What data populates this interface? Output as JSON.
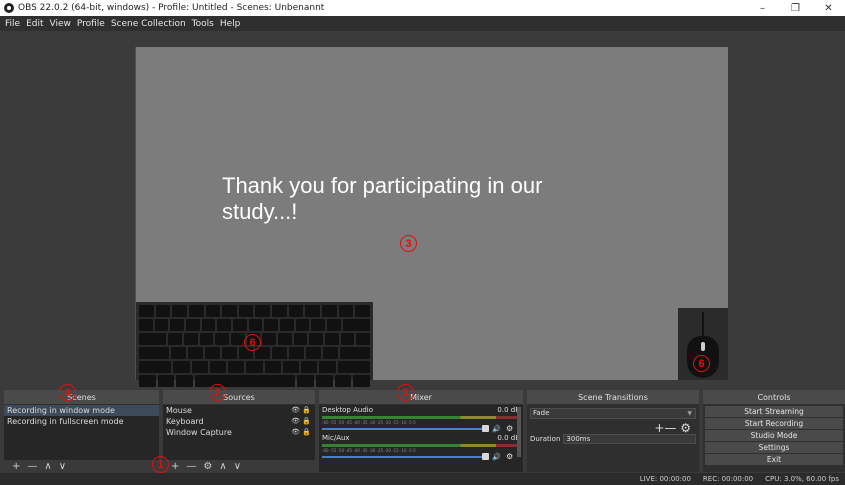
{
  "window": {
    "title": "OBS 22.0.2 (64-bit, windows) - Profile: Untitled - Scenes: Unbenannt",
    "minimize": "–",
    "maximize": "❐",
    "close": "✕"
  },
  "menu": [
    "File",
    "Edit",
    "View",
    "Profile",
    "Scene Collection",
    "Tools",
    "Help"
  ],
  "preview": {
    "text": "Thank you for participating in our study...!",
    "markers": {
      "canvas": "3",
      "keyboard": "6",
      "mouse": "6"
    }
  },
  "scenes": {
    "title": "Scenes",
    "marker": "4",
    "items": [
      "Recording in window mode",
      "Recording in fullscreen mode"
    ],
    "footer": [
      "+",
      "—",
      "∧",
      "∨"
    ]
  },
  "sources": {
    "title": "Sources",
    "marker": "2",
    "footer_marker": "1",
    "items": [
      "Mouse",
      "Keyboard",
      "Window Capture"
    ],
    "item_icons": "👁 🔒",
    "footer": [
      "+",
      "—",
      "⚙",
      "∧",
      "∨"
    ]
  },
  "mixer": {
    "title": "Mixer",
    "marker": "5",
    "channels": [
      {
        "name": "Desktop Audio",
        "level": "0.0 dB"
      },
      {
        "name": "Mic/Aux",
        "level": "0.0 dB"
      }
    ],
    "ticks": "-60 -55 -50 -45 -40 -35 -30 -25 -20 -15 -10 -5 0"
  },
  "transitions": {
    "title": "Scene Transitions",
    "selected": "Fade",
    "add_remove": "+— ⚙",
    "duration_label": "Duration",
    "duration_value": "300ms"
  },
  "controls": {
    "title": "Controls",
    "buttons": [
      "Start Streaming",
      "Start Recording",
      "Studio Mode",
      "Settings",
      "Exit"
    ]
  },
  "status": {
    "live": "LIVE: 00:00:00",
    "rec": "REC: 00:00:00",
    "cpu": "CPU: 3.0%, 60.00 fps"
  },
  "colors": {
    "marker": "#e01010",
    "canvas": "#7c7c7c",
    "panel": "#2f2f2f",
    "accent_slider": "#4a7bd8"
  }
}
